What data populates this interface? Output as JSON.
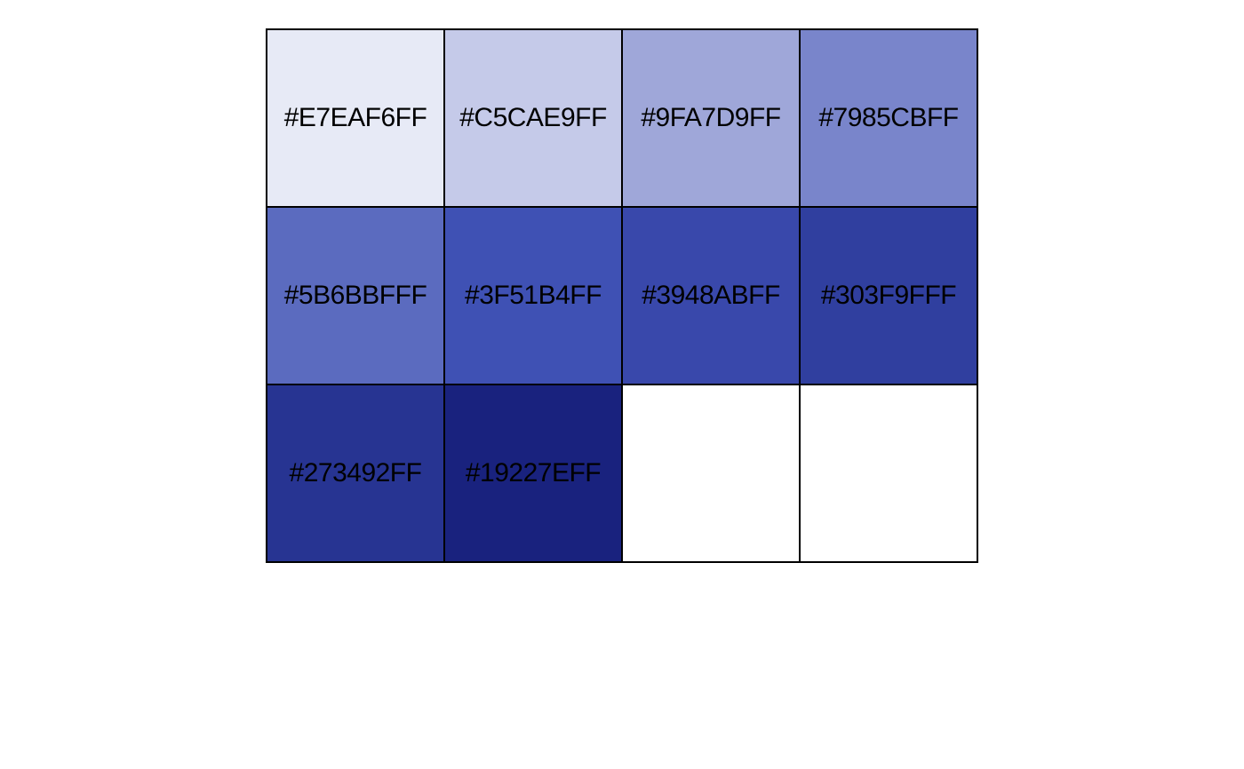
{
  "swatches": [
    {
      "label": "#E7EAF6FF",
      "color": "#E7EAF6"
    },
    {
      "label": "#C5CAE9FF",
      "color": "#C5CAE9"
    },
    {
      "label": "#9FA7D9FF",
      "color": "#9FA7D9"
    },
    {
      "label": "#7985CBFF",
      "color": "#7985CB"
    },
    {
      "label": "#5B6BBFFF",
      "color": "#5B6BBF"
    },
    {
      "label": "#3F51B4FF",
      "color": "#3F51B4"
    },
    {
      "label": "#3948ABFF",
      "color": "#3948AB"
    },
    {
      "label": "#303F9FFF",
      "color": "#303F9F"
    },
    {
      "label": "#273492FF",
      "color": "#273492"
    },
    {
      "label": "#19227EFF",
      "color": "#19227E"
    },
    {
      "label": "",
      "color": "#FFFFFF"
    },
    {
      "label": "",
      "color": "#FFFFFF"
    }
  ]
}
